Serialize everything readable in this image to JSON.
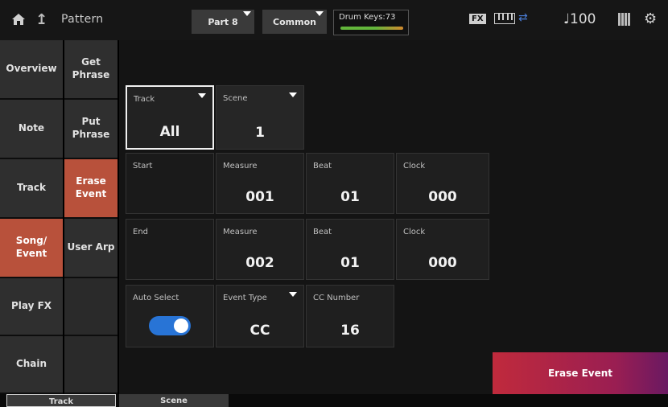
{
  "header": {
    "title": "Pattern",
    "part_label": "Part 8",
    "common_label": "Common",
    "drum_keys_label": "Drum Keys:73",
    "fx_badge": "FX",
    "tempo": "♩100"
  },
  "left_tabs": [
    {
      "label": "Overview"
    },
    {
      "label": "Note"
    },
    {
      "label": "Track"
    },
    {
      "label": "Song/\nEvent"
    },
    {
      "label": "Play FX"
    },
    {
      "label": "Chain"
    }
  ],
  "sub_tabs": [
    {
      "label": "Get\nPhrase"
    },
    {
      "label": "Put\nPhrase"
    },
    {
      "label": "Erase\nEvent"
    },
    {
      "label": "User Arp"
    }
  ],
  "form": {
    "track": {
      "label": "Track",
      "value": "All"
    },
    "scene": {
      "label": "Scene",
      "value": "1"
    },
    "start": {
      "label": "Start",
      "measure_label": "Measure",
      "measure": "001",
      "beat_label": "Beat",
      "beat": "01",
      "clock_label": "Clock",
      "clock": "000"
    },
    "end": {
      "label": "End",
      "measure_label": "Measure",
      "measure": "002",
      "beat_label": "Beat",
      "beat": "01",
      "clock_label": "Clock",
      "clock": "000"
    },
    "auto_select": {
      "label": "Auto Select",
      "on": true
    },
    "event_type": {
      "label": "Event Type",
      "value": "CC"
    },
    "cc_number": {
      "label": "CC Number",
      "value": "16"
    }
  },
  "erase_button": "Erase Event",
  "bottom_tabs": [
    {
      "label": "Track"
    },
    {
      "label": "Scene"
    }
  ],
  "colors": {
    "active_tab": "#b8513b",
    "toggle_on": "#2874d6",
    "erase_start": "#c02a3c",
    "erase_end": "#6a1962"
  }
}
